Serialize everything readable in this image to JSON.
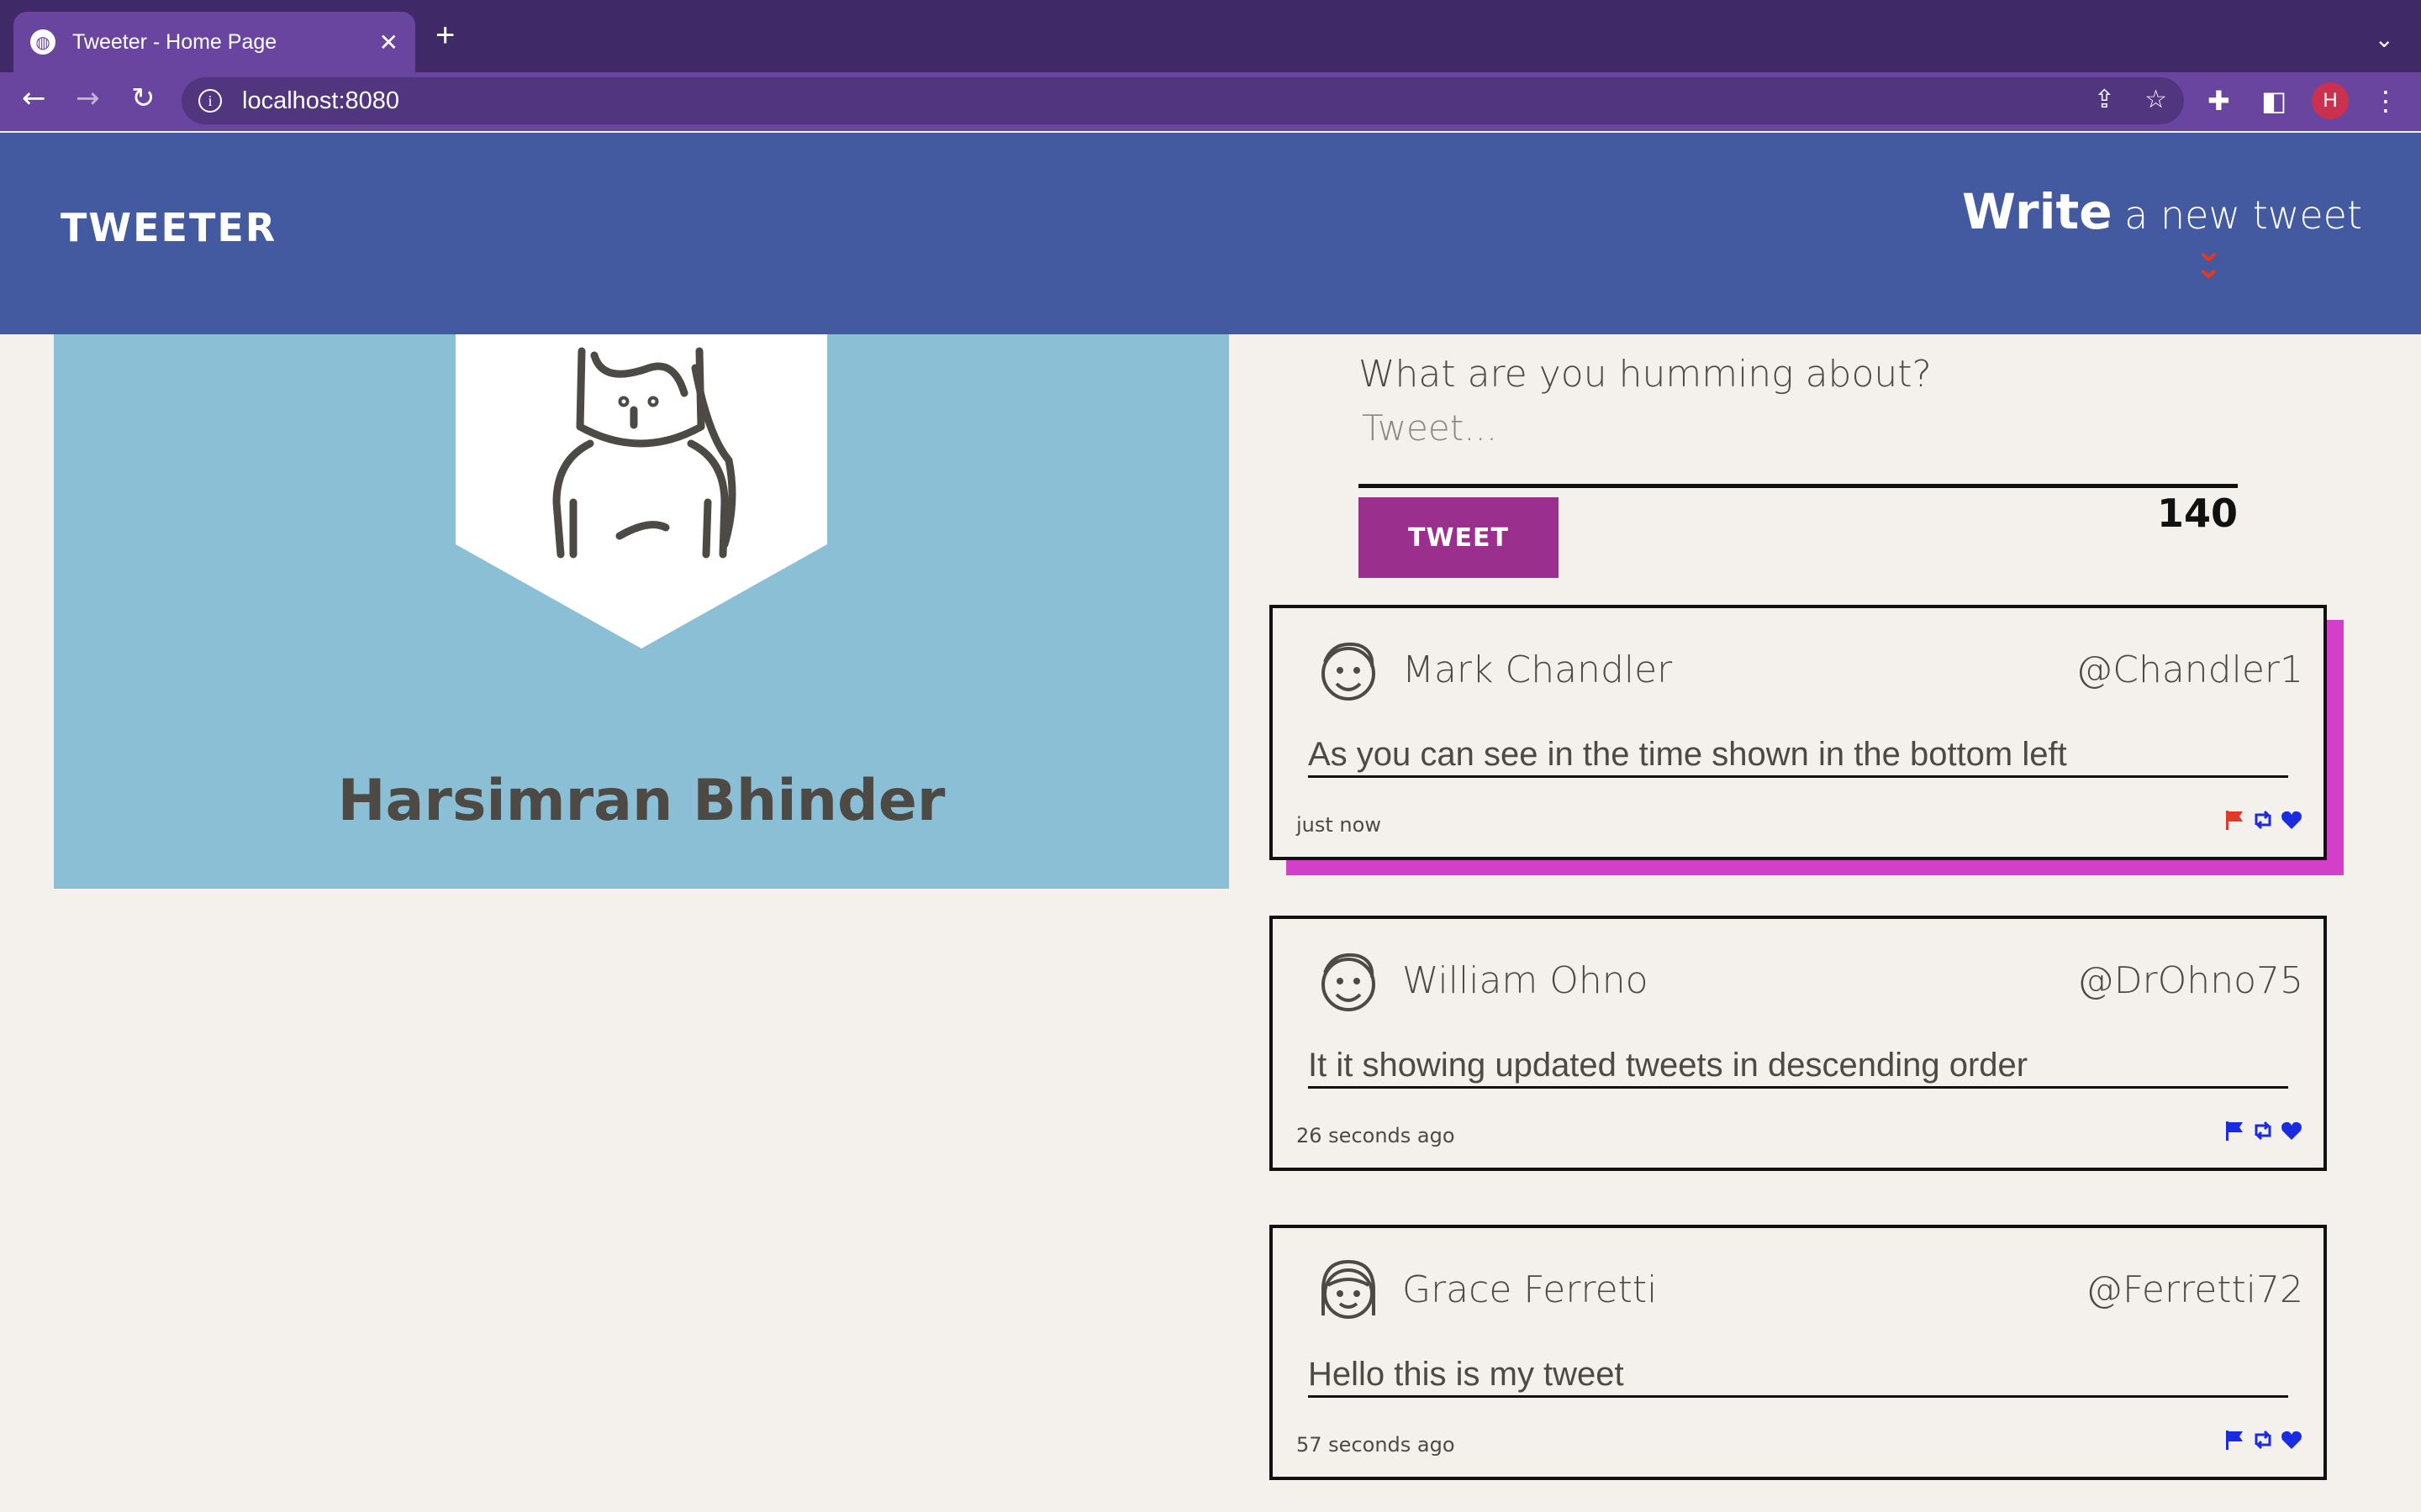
{
  "browser": {
    "tab_title": "Tweeter - Home Page",
    "tab_close": "✕",
    "new_tab": "+",
    "url": "localhost:8080",
    "avatar_letter": "H"
  },
  "header": {
    "logo": "TWEETER",
    "write_strong": "Write",
    "write_rest": " a new tweet"
  },
  "profile": {
    "name": "Harsimran Bhinder"
  },
  "composer": {
    "prompt": "What are you humming about?",
    "placeholder": "Tweet...",
    "button_label": "TWEET",
    "counter": "140"
  },
  "tweets": [
    {
      "name": "Mark Chandler",
      "handle": "@Chandler1",
      "body": "As you can see in the time shown in the bottom left",
      "time": "just now",
      "flag_color": "#e0392b"
    },
    {
      "name": "William Ohno",
      "handle": "@DrOhno75",
      "body": "It it showing updated tweets in descending order",
      "time": "26 seconds ago",
      "flag_color": "#1a2be0"
    },
    {
      "name": "Grace Ferretti",
      "handle": "@Ferretti72",
      "body": "Hello this is my tweet",
      "time": "57 seconds ago",
      "flag_color": "#1a2be0"
    }
  ]
}
